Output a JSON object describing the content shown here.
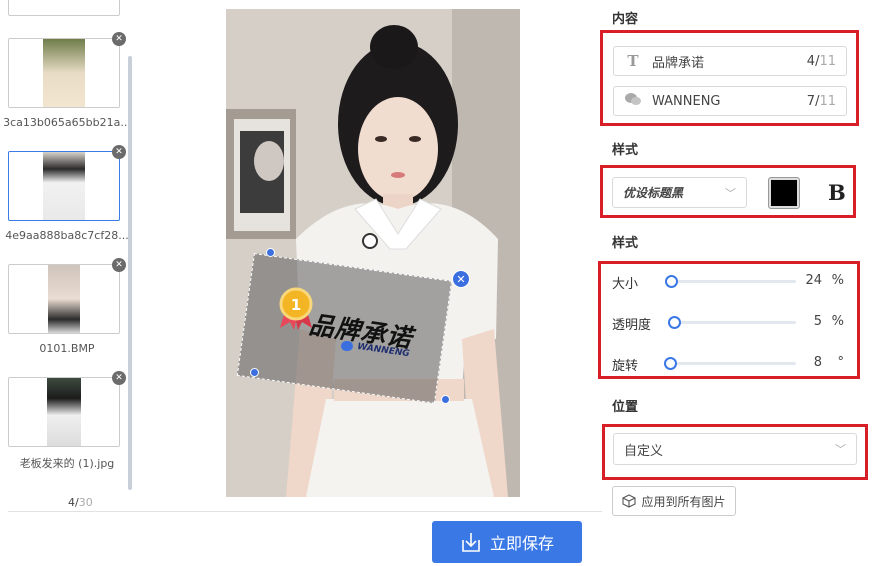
{
  "thumbnails": [
    {
      "caption": "3ca13b065a65bb21a...",
      "active": false
    },
    {
      "caption": "4e9aa888ba8c7cf28...",
      "active": true
    },
    {
      "caption": "0101.BMP",
      "active": false
    },
    {
      "caption": "老板发来的 (1).jpg",
      "active": false
    }
  ],
  "pagination": {
    "current": "4",
    "total": "30"
  },
  "preview": {
    "watermark_text": "品牌承诺",
    "watermark_sub": "WANNENG",
    "close_symbol": "✕",
    "badge_number": "1"
  },
  "save_button": {
    "label": "立即保存",
    "icon": "download-tray-icon"
  },
  "content_section": {
    "title": "内容",
    "fields": [
      {
        "icon": "text-T-icon",
        "value": "品牌承诺",
        "count": "4",
        "max": "11"
      },
      {
        "icon": "wechat-icon",
        "value": "WANNENG",
        "count": "7",
        "max": "11"
      }
    ]
  },
  "style_section": {
    "title": "样式",
    "font": "优设标题黑",
    "color": "#000000",
    "bold_label": "B"
  },
  "style_section2": {
    "title": "样式",
    "sliders": [
      {
        "label": "大小",
        "value": "24",
        "unit": "%"
      },
      {
        "label": "透明度",
        "value": "5",
        "unit": "%"
      },
      {
        "label": "旋转",
        "value": "8",
        "unit": "°"
      }
    ]
  },
  "position_section": {
    "title": "位置",
    "selected": "自定义"
  },
  "apply_button": {
    "label": "应用到所有图片"
  }
}
